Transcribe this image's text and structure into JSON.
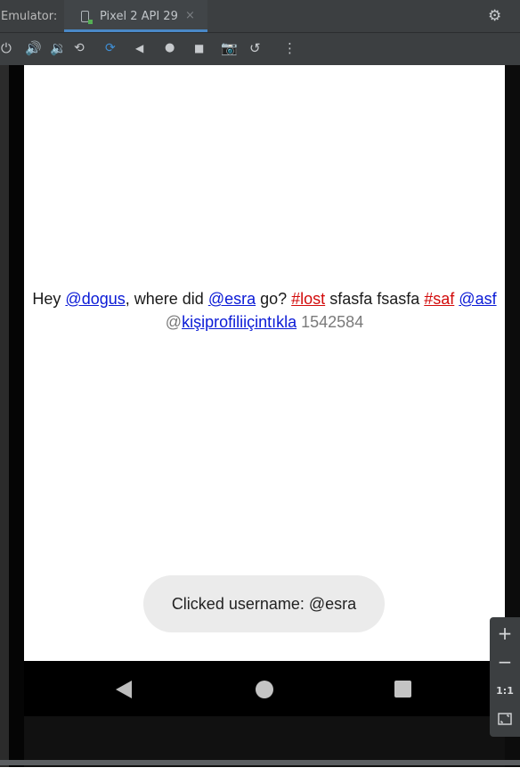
{
  "ide": {
    "panel_title": "Emulator:",
    "tab_label": "Pixel 2 API 29",
    "tab_close": "×",
    "settings_icon": "gear-icon"
  },
  "toolbar": {
    "icons": [
      "power-icon",
      "volume-up-icon",
      "volume-down-icon",
      "rotate-left-icon",
      "rotate-right-icon",
      "back-icon",
      "home-icon",
      "overview-icon",
      "screenshot-icon",
      "snapshot-icon",
      "more-icon"
    ]
  },
  "screen": {
    "message": {
      "hey": "Hey ",
      "mention1": "@dogus",
      "text1": ", where did ",
      "mention2": "@esra",
      "text2": " go? ",
      "hashtag1": "#lost",
      "text3": " sfasfa fsasfa ",
      "hashtag2": "#saf",
      "text4": " ",
      "mention3": "@asf",
      "at_prefix": "@",
      "profile_link": "kişiprofiliiçintıkla",
      "number": " 1542584"
    },
    "toast": "Clicked username: @esra"
  },
  "colors": {
    "mention": "#0a1ad6",
    "hashtag": "#d20a0a",
    "ide_bg": "#3c3f41",
    "tab_underline": "#4a88c7"
  },
  "zoom": {
    "zoom_in": "+",
    "zoom_out": "−",
    "actual_size": "1:1",
    "fit_icon": "fit-screen-icon"
  }
}
